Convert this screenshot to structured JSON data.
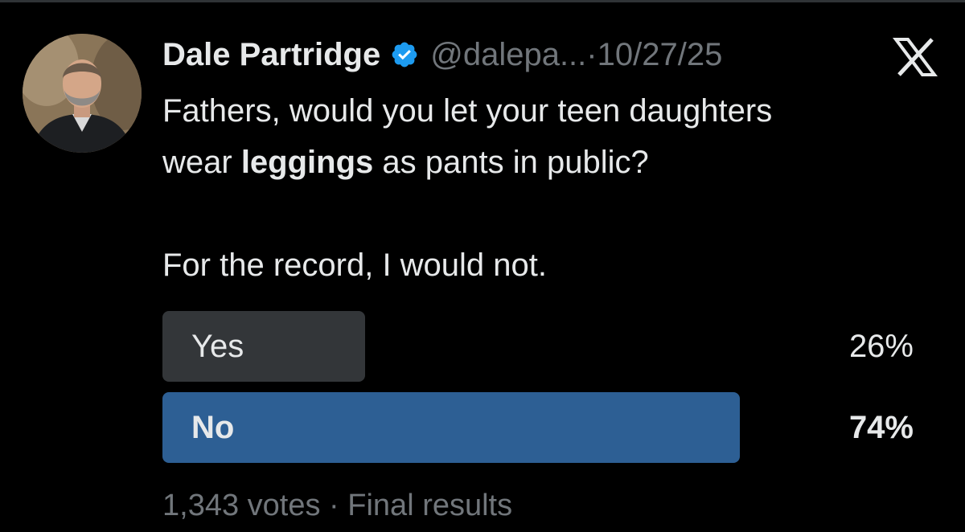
{
  "tweet": {
    "author_name": "Dale Partridge",
    "verified": true,
    "handle": "@dalepa...",
    "separator": "·",
    "date": "10/27/25",
    "platform_icon": "x-logo-icon",
    "text_part1": "Fathers, would you let your teen daughters\nwear ",
    "text_bold": "leggings",
    "text_part2": " as pants in public?\n\nFor the record, I would not."
  },
  "poll": {
    "options": [
      {
        "label": "Yes",
        "percent_label": "26%",
        "percent": 26,
        "winner": false
      },
      {
        "label": "No",
        "percent_label": "74%",
        "percent": 74,
        "winner": true
      }
    ],
    "votes": "1,343 votes",
    "separator": "·",
    "status": "Final results"
  },
  "colors": {
    "background": "#000000",
    "text": "#e7e9ea",
    "muted": "#71767b",
    "winner_bar": "#2d5f94",
    "loser_bar": "#333639",
    "verified": "#1d9bf0"
  }
}
